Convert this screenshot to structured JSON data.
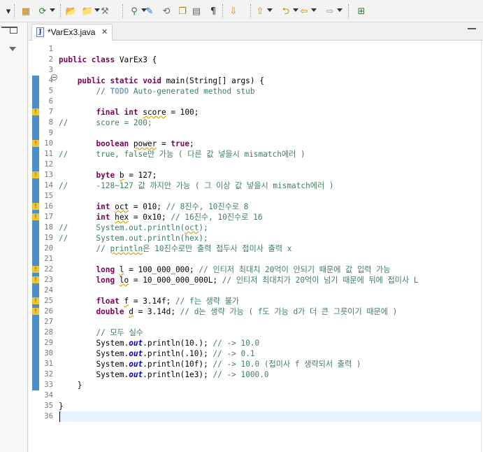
{
  "window": {
    "editor_tab_label": "*VarEx3.java",
    "tab_close_glyph": "✕"
  },
  "toolbar": {
    "icons": [
      "new-dropdown-icon",
      "package-icon",
      "debug-run-icon",
      "open-folder-icon",
      "open-icon",
      "build-icon",
      "search-icon",
      "pen-icon",
      "refresh-icon",
      "copy-icon",
      "document-icon",
      "paragraph-icon",
      "next-annotation-icon",
      "prev-annotation-icon",
      "back-icon",
      "back-arrow-icon",
      "forward-arrow-icon",
      "perspective-icon"
    ]
  },
  "colors": {
    "keyword": "#7f0055",
    "comment": "#3f7f5f",
    "static_field": "#0000c0",
    "current_line": "#e8f2fe",
    "change_marker": "#4a8fc9",
    "warning": "#f4c430"
  },
  "editor": {
    "line_numbers": [
      "1",
      "2",
      "3",
      "4",
      "5",
      "6",
      "7",
      "8",
      "9",
      "10",
      "11",
      "12",
      "13",
      "14",
      "15",
      "16",
      "17",
      "18",
      "19",
      "20",
      "21",
      "22",
      "23",
      "24",
      "25",
      "26",
      "27",
      "28",
      "29",
      "30",
      "31",
      "32",
      "33",
      "34",
      "35",
      "36"
    ],
    "warning_lines": [
      6,
      9,
      12,
      15,
      16,
      21,
      22,
      24,
      25
    ],
    "change_ranges": [
      [
        3,
        32
      ]
    ],
    "current_line": 35,
    "lines": [
      [],
      [
        {
          "t": "public class ",
          "c": "kw"
        },
        {
          "t": "VarEx3 {"
        }
      ],
      [],
      [
        {
          "t": "    "
        },
        {
          "t": "public static void ",
          "c": "kw"
        },
        {
          "t": "main(String[] "
        },
        {
          "t": "args",
          "c": "var"
        },
        {
          "t": ") {"
        }
      ],
      [
        {
          "t": "        "
        },
        {
          "t": "// ",
          "c": "cm"
        },
        {
          "t": "TODO",
          "c": "tag"
        },
        {
          "t": " Auto-generated method stub",
          "c": "cm"
        }
      ],
      [],
      [
        {
          "t": "        "
        },
        {
          "t": "final int ",
          "c": "kw"
        },
        {
          "t": "score",
          "c": "sq"
        },
        {
          "t": " = 100;"
        }
      ],
      [
        {
          "t": "//",
          "c": "cm"
        },
        {
          "t": "      score = 200;",
          "c": "cm"
        }
      ],
      [],
      [
        {
          "t": "        "
        },
        {
          "t": "boolean ",
          "c": "kw"
        },
        {
          "t": "power",
          "c": "sq"
        },
        {
          "t": " = "
        },
        {
          "t": "true",
          "c": "kw"
        },
        {
          "t": ";"
        }
      ],
      [
        {
          "t": "//",
          "c": "cm"
        },
        {
          "t": "      true, false만 가능 ( 다른 값 넣을시 mismatch에러 )",
          "c": "cm"
        }
      ],
      [],
      [
        {
          "t": "        "
        },
        {
          "t": "byte ",
          "c": "kw"
        },
        {
          "t": "b",
          "c": "sq"
        },
        {
          "t": " = 127;"
        }
      ],
      [
        {
          "t": "//",
          "c": "cm"
        },
        {
          "t": "      -128~127 값 까지만 가능 ( 그 이상 값 넣을시 mismatch에러 )",
          "c": "cm"
        }
      ],
      [],
      [
        {
          "t": "        "
        },
        {
          "t": "int ",
          "c": "kw"
        },
        {
          "t": "oct",
          "c": "sq"
        },
        {
          "t": " = 010; "
        },
        {
          "t": "// 8진수, 10진수로 8",
          "c": "cm"
        }
      ],
      [
        {
          "t": "        "
        },
        {
          "t": "int ",
          "c": "kw"
        },
        {
          "t": "hex",
          "c": "sq"
        },
        {
          "t": " = 0x10; "
        },
        {
          "t": "// 16진수, 10진수로 16",
          "c": "cm"
        }
      ],
      [
        {
          "t": "//",
          "c": "cm"
        },
        {
          "t": "      System.out.println(",
          "c": "cm"
        },
        {
          "t": "oct",
          "c": "cm sq"
        },
        {
          "t": ");",
          "c": "cm"
        }
      ],
      [
        {
          "t": "//",
          "c": "cm"
        },
        {
          "t": "      System.out.println(hex);",
          "c": "cm"
        }
      ],
      [
        {
          "t": "        "
        },
        {
          "t": "// ",
          "c": "cm"
        },
        {
          "t": "println",
          "c": "cm sq"
        },
        {
          "t": "은 10진수로만 출력 접두사 접미사 출력 x",
          "c": "cm"
        }
      ],
      [],
      [
        {
          "t": "        "
        },
        {
          "t": "long ",
          "c": "kw"
        },
        {
          "t": "l",
          "c": "sq"
        },
        {
          "t": " = 100_000_000; "
        },
        {
          "t": "// 인티저 최대치 20억이 안되기 때문에 값 입력 가능",
          "c": "cm"
        }
      ],
      [
        {
          "t": "        "
        },
        {
          "t": "long ",
          "c": "kw"
        },
        {
          "t": "lo",
          "c": "sq"
        },
        {
          "t": " = 10_000_000_000L; "
        },
        {
          "t": "// 인티저 최대치가 20억이 넘기 때문에 뒤에 접미사 L",
          "c": "cm"
        }
      ],
      [],
      [
        {
          "t": "        "
        },
        {
          "t": "float ",
          "c": "kw"
        },
        {
          "t": "f",
          "c": "sq"
        },
        {
          "t": " = 3.14f; "
        },
        {
          "t": "// f는 생략 불가",
          "c": "cm"
        }
      ],
      [
        {
          "t": "        "
        },
        {
          "t": "double ",
          "c": "kw"
        },
        {
          "t": "d",
          "c": "sq"
        },
        {
          "t": " = 3.14d; "
        },
        {
          "t": "// d는 생략 가능 ( f도 가능 d가 더 큰 그릇이기 때문에 )",
          "c": "cm"
        }
      ],
      [],
      [
        {
          "t": "        "
        },
        {
          "t": "// 모두 실수",
          "c": "cm"
        }
      ],
      [
        {
          "t": "        "
        },
        {
          "t": "System."
        },
        {
          "t": "out",
          "c": "st"
        },
        {
          "t": ".println(10.); "
        },
        {
          "t": "// -> 10.0",
          "c": "cm"
        }
      ],
      [
        {
          "t": "        "
        },
        {
          "t": "System."
        },
        {
          "t": "out",
          "c": "st"
        },
        {
          "t": ".println(.10); "
        },
        {
          "t": "// -> 0.1",
          "c": "cm"
        }
      ],
      [
        {
          "t": "        "
        },
        {
          "t": "System."
        },
        {
          "t": "out",
          "c": "st"
        },
        {
          "t": ".println(10f); "
        },
        {
          "t": "// -> 10.0 (접미사 f 생략되서 출력 )",
          "c": "cm"
        }
      ],
      [
        {
          "t": "        "
        },
        {
          "t": "System."
        },
        {
          "t": "out",
          "c": "st"
        },
        {
          "t": ".println(1e3); "
        },
        {
          "t": "// -> 1000.0",
          "c": "cm"
        }
      ],
      [
        {
          "t": "    }"
        }
      ],
      [],
      [
        {
          "t": "}"
        }
      ],
      []
    ]
  }
}
